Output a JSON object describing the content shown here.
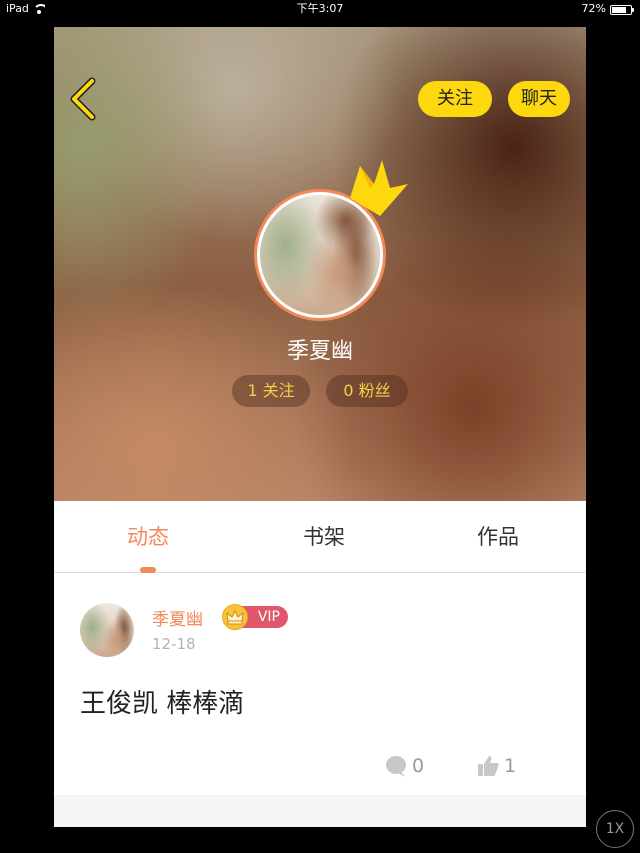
{
  "status_bar": {
    "device": "iPad",
    "time": "下午3:07",
    "battery": "72%",
    "battery_level": 0.72
  },
  "profile": {
    "back_icon": "chevron-left-icon",
    "follow_label": "关注",
    "chat_label": "聊天",
    "crown_icon": "crown-icon",
    "name": "季夏幽",
    "following": "1 关注",
    "fans": "0 粉丝"
  },
  "tabs": [
    {
      "label": "动态",
      "active": true
    },
    {
      "label": "书架",
      "active": false
    },
    {
      "label": "作品",
      "active": false
    }
  ],
  "post": {
    "author": "季夏幽",
    "vip_label": "VIP",
    "date": "12-18",
    "content": "王俊凯 棒棒滴",
    "comment_count": "0",
    "like_count": "1"
  },
  "colors": {
    "accent": "#f5895a",
    "pill_yellow": "#fdd80e",
    "stat_text": "#f6d04a",
    "vip_red": "#e0566a"
  },
  "player": {
    "speed_label": "1X"
  }
}
